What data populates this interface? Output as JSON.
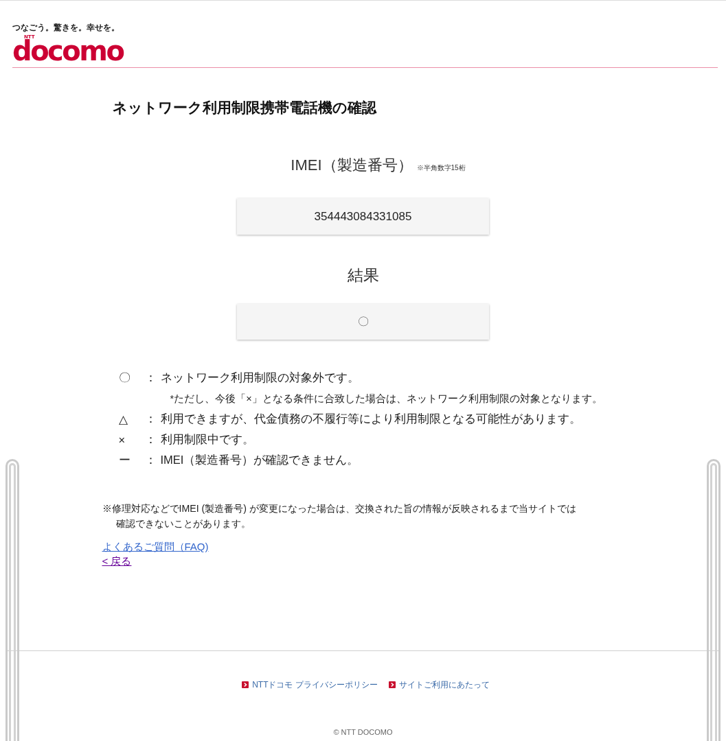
{
  "header": {
    "tagline": "つなごう。驚きを。幸せを。",
    "logo": {
      "mark": "NTT",
      "wordmark": "docomo"
    }
  },
  "page_title": "ネットワーク利用制限携帯電話機の確認",
  "imei_field": {
    "label": "IMEI（製造番号）",
    "hint": "※半角数字15桁",
    "value": "354443084331085"
  },
  "result": {
    "label": "結果",
    "value": "〇"
  },
  "legend": [
    {
      "symbol": "〇",
      "separator": "：",
      "text": "ネットワーク利用制限の対象外です。",
      "note": "*ただし、今後「×」となる条件に合致した場合は、ネットワーク利用制限の対象となります。"
    },
    {
      "symbol": "△",
      "separator": "：",
      "text": "利用できますが、代金債務の不履行等により利用制限となる可能性があります。"
    },
    {
      "symbol": "×",
      "separator": "：",
      "text": "利用制限中です。"
    },
    {
      "symbol": "ー",
      "separator": "：",
      "text": "IMEI（製造番号）が確認できません。"
    }
  ],
  "notice": {
    "lines": [
      "※修理対応などでIMEI (製造番号) が変更になった場合は、交換された旨の情報が反映されるまで当サイトでは",
      "確認できないことがあります。"
    ]
  },
  "links": [
    {
      "label": "よくあるご質問（FAQ)",
      "visited": false
    },
    {
      "label": "< 戻る",
      "visited": true
    }
  ],
  "footer": {
    "links": [
      "NTTドコモ プライバシーポリシー",
      "サイトご利用にあたって"
    ],
    "copyright": "© NTT DOCOMO"
  }
}
